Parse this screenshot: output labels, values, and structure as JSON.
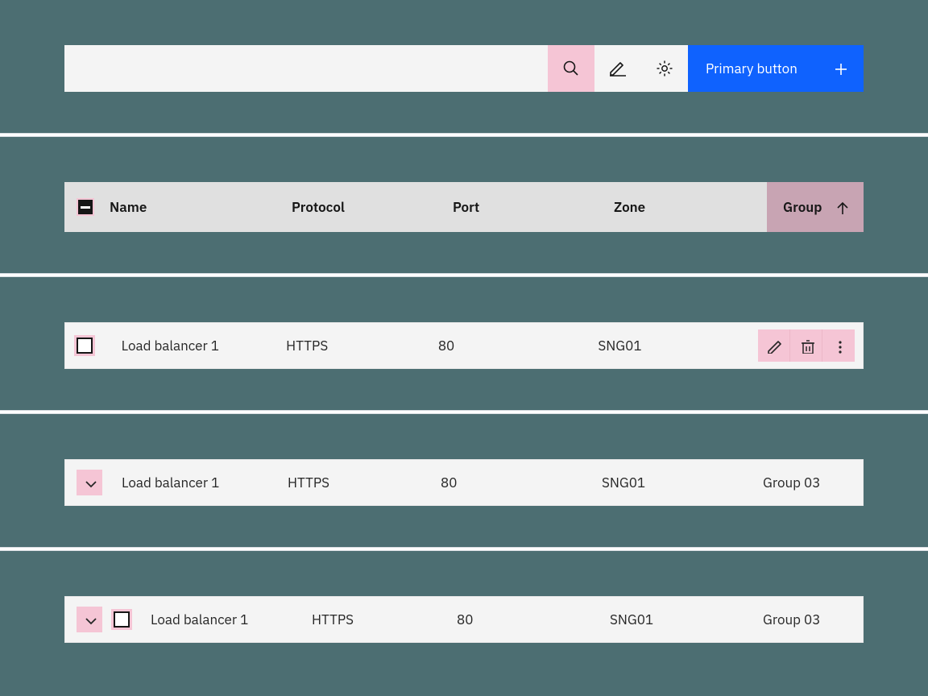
{
  "toolbar": {
    "primary_label": "Primary button"
  },
  "columns": {
    "name": "Name",
    "protocol": "Protocol",
    "port": "Port",
    "zone": "Zone",
    "group": "Group"
  },
  "rows": [
    {
      "name": "Load balancer 1",
      "protocol": "HTTPS",
      "port": "80",
      "zone": "SNG01",
      "group": ""
    },
    {
      "name": "Load balancer 1",
      "protocol": "HTTPS",
      "port": "80",
      "zone": "SNG01",
      "group": "Group 03"
    },
    {
      "name": "Load balancer 1",
      "protocol": "HTTPS",
      "port": "80",
      "zone": "SNG01",
      "group": "Group 03"
    }
  ],
  "colors": {
    "highlight": "#f5c5d5",
    "primary": "#0f62fe",
    "bg": "#4c6e72",
    "header_active": "#c8a4b3"
  }
}
